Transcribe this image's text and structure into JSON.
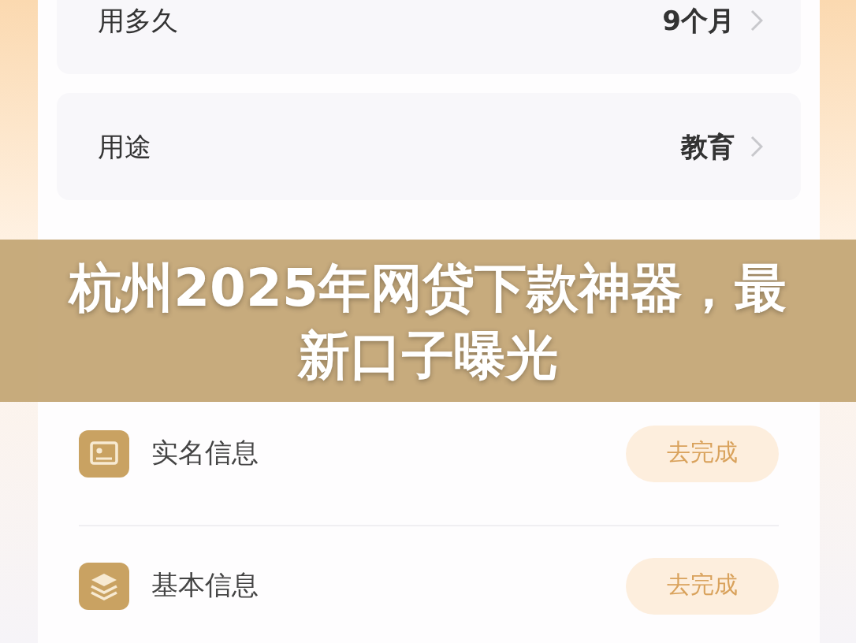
{
  "fields": [
    {
      "label": "用多久",
      "value": "9个月"
    },
    {
      "label": "用途",
      "value": "教育"
    }
  ],
  "banner": {
    "title": "杭州2025年网贷下款神器，最新口子曝光"
  },
  "tasks": [
    {
      "kind": "id",
      "label": "实名信息",
      "action": "去完成"
    },
    {
      "kind": "layers",
      "label": "基本信息",
      "action": "去完成"
    }
  ]
}
